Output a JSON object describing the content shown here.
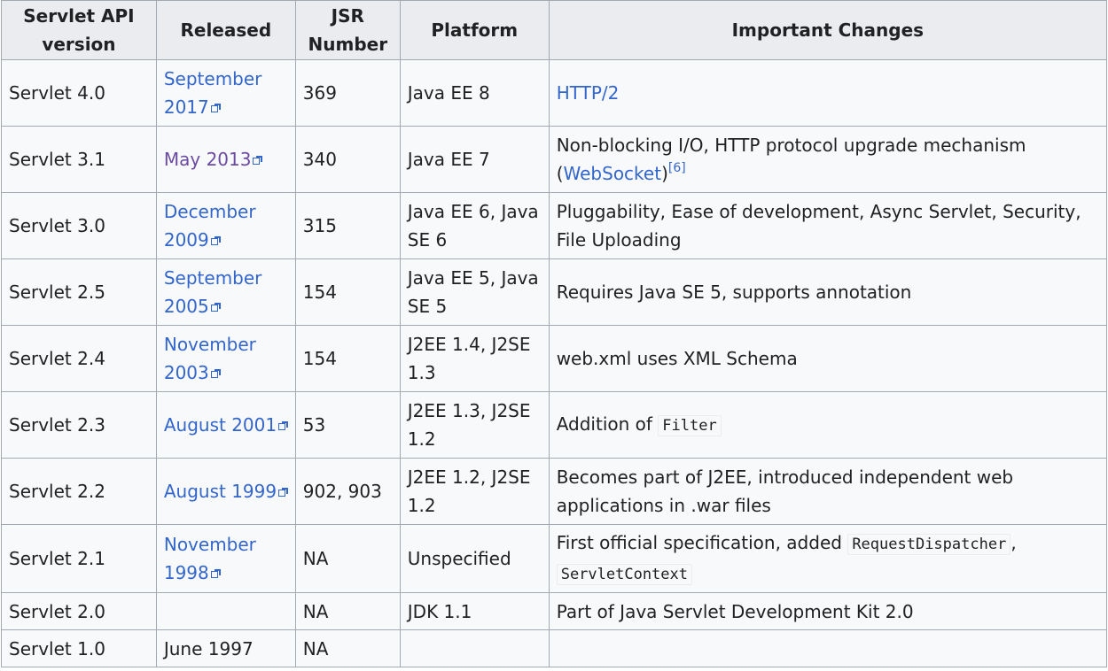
{
  "headers": {
    "version": "Servlet API version",
    "released": "Released",
    "jsr": "JSR Number",
    "platform": "Platform",
    "changes": "Important Changes"
  },
  "rows": [
    {
      "version": "Servlet 4.0",
      "released": "September 2017",
      "jsr": "369",
      "platform": "Java EE 8",
      "changes": {
        "link": "HTTP/2"
      }
    },
    {
      "version": "Servlet 3.1",
      "released": "May 2013",
      "jsr": "340",
      "platform": "Java EE 7",
      "changes": {
        "text": "Non-blocking I/O, HTTP protocol upgrade mechanism (",
        "link": "WebSocket",
        "text_after": ")",
        "ref": "[6]"
      }
    },
    {
      "version": "Servlet 3.0",
      "released": "December 2009",
      "jsr": "315",
      "platform": "Java EE 6, Java SE 6",
      "changes": {
        "text": "Pluggability, Ease of development, Async Servlet, Security, File Uploading"
      }
    },
    {
      "version": "Servlet 2.5",
      "released": "September 2005",
      "jsr": "154",
      "platform": "Java EE 5, Java SE 5",
      "changes": {
        "text": "Requires Java SE 5, supports annotation"
      }
    },
    {
      "version": "Servlet 2.4",
      "released": "November 2003",
      "jsr": "154",
      "platform": "J2EE 1.4, J2SE 1.3",
      "changes": {
        "text": "web.xml uses XML Schema"
      }
    },
    {
      "version": "Servlet 2.3",
      "released": "August 2001",
      "jsr": "53",
      "platform": "J2EE 1.3, J2SE 1.2",
      "changes": {
        "text": "Addition of",
        "code1": "Filter"
      }
    },
    {
      "version": "Servlet 2.2",
      "released": "August 1999",
      "jsr": "902, 903",
      "platform": "J2EE 1.2, J2SE 1.2",
      "changes": {
        "text": "Becomes part of J2EE, introduced independent web applications in .war files"
      }
    },
    {
      "version": "Servlet 2.1",
      "released": "November 1998",
      "jsr": "NA",
      "platform": "Unspecified",
      "changes": {
        "text": "First official specification, added",
        "code1": "RequestDispatcher",
        "sep": ",",
        "code2": "ServletContext"
      }
    },
    {
      "version": "Servlet 2.0",
      "released": "",
      "jsr": "NA",
      "platform": "JDK 1.1",
      "changes": {
        "text": "Part of Java Servlet Development Kit 2.0"
      }
    },
    {
      "version": "Servlet 1.0",
      "released": "June 1997",
      "jsr": "NA",
      "platform": "",
      "changes": {
        "text": ""
      }
    }
  ],
  "colors": {
    "link": "#3366cc",
    "visited_link": "#6b4ba1",
    "header_bg": "#eaecf0",
    "cell_bg": "#f8f9fa",
    "border": "#a2a9b1"
  }
}
